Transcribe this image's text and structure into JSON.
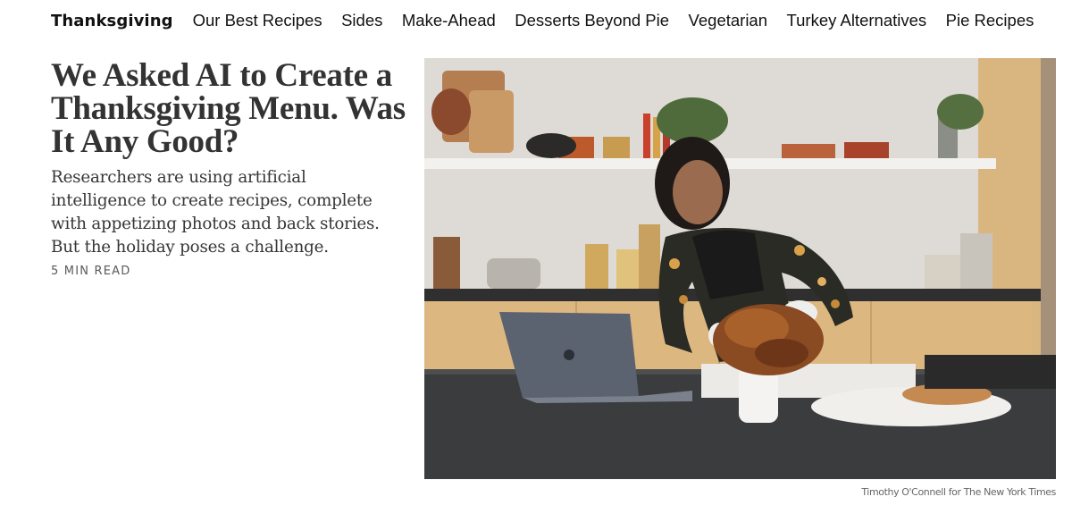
{
  "nav": {
    "section": "Thanksgiving",
    "items": [
      "Our Best Recipes",
      "Sides",
      "Make-Ahead",
      "Desserts Beyond Pie",
      "Vegetarian",
      "Turkey Alternatives",
      "Pie Recipes"
    ]
  },
  "article": {
    "headline": "We Asked AI to Create a Thanksgiving Menu. Was It Any Good?",
    "summary": "Researchers are using artificial intelligence to create recipes, complete with appetizing photos and back stories. But the holiday poses a challenge.",
    "read_time": "5 MIN READ",
    "photo_credit": "Timothy O'Connell for The New York Times"
  }
}
